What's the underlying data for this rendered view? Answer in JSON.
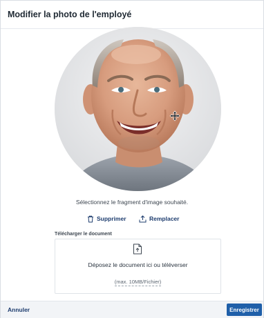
{
  "modal": {
    "title": "Modifier la photo de l'employé"
  },
  "cropper": {
    "photo_alt": "Photo de l'employé",
    "move_icon": "move-icon",
    "instruction": "Sélectionnez le fragment d'image souhaité."
  },
  "actions": {
    "delete_label": "Supprimer",
    "delete_icon": "trash-icon",
    "replace_label": "Remplacer",
    "replace_icon": "upload-icon"
  },
  "upload": {
    "label": "Télécharger le document",
    "icon": "file-upload-icon",
    "drop_text": "Déposez le document ici ou téléverser",
    "limit_text": "(max. 10MB/Fichier)"
  },
  "footer": {
    "cancel_label": "Annuler",
    "save_label": "Enregistrer"
  },
  "colors": {
    "primary": "#1f5fa9",
    "link": "#1d3c6e",
    "footer_bg": "#f2f4f7"
  }
}
